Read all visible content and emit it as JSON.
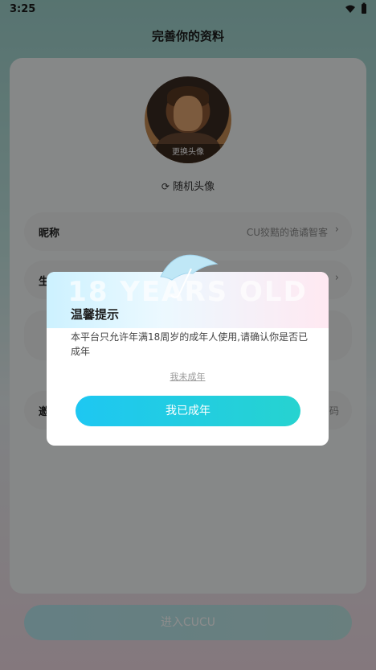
{
  "status_bar": {
    "time": "3:25",
    "icons": [
      "wifi-icon",
      "battery-icon"
    ]
  },
  "header": {
    "title": "完善你的资料"
  },
  "avatar": {
    "change_label": "更换头像"
  },
  "random_avatar": {
    "label": "随机头像"
  },
  "rows": [
    {
      "label": "昵称",
      "value": "CU狡黠的诡谲智客"
    },
    {
      "label": "生"
    },
    {
      "label": ""
    },
    {
      "label": "邀",
      "value": "码"
    }
  ],
  "enter_button": {
    "label": "进入CUCU"
  },
  "dialog": {
    "title": "温馨提示",
    "message": "本平台只允许年满18周岁的成年人使用,请确认你是否已成年",
    "not_adult_label": "我未成年",
    "confirm_label": "我已成年",
    "banner_text": "18 YEARS OLD"
  },
  "colors": {
    "accent_start": "#1ec7f2",
    "accent_end": "#26d3d0"
  }
}
